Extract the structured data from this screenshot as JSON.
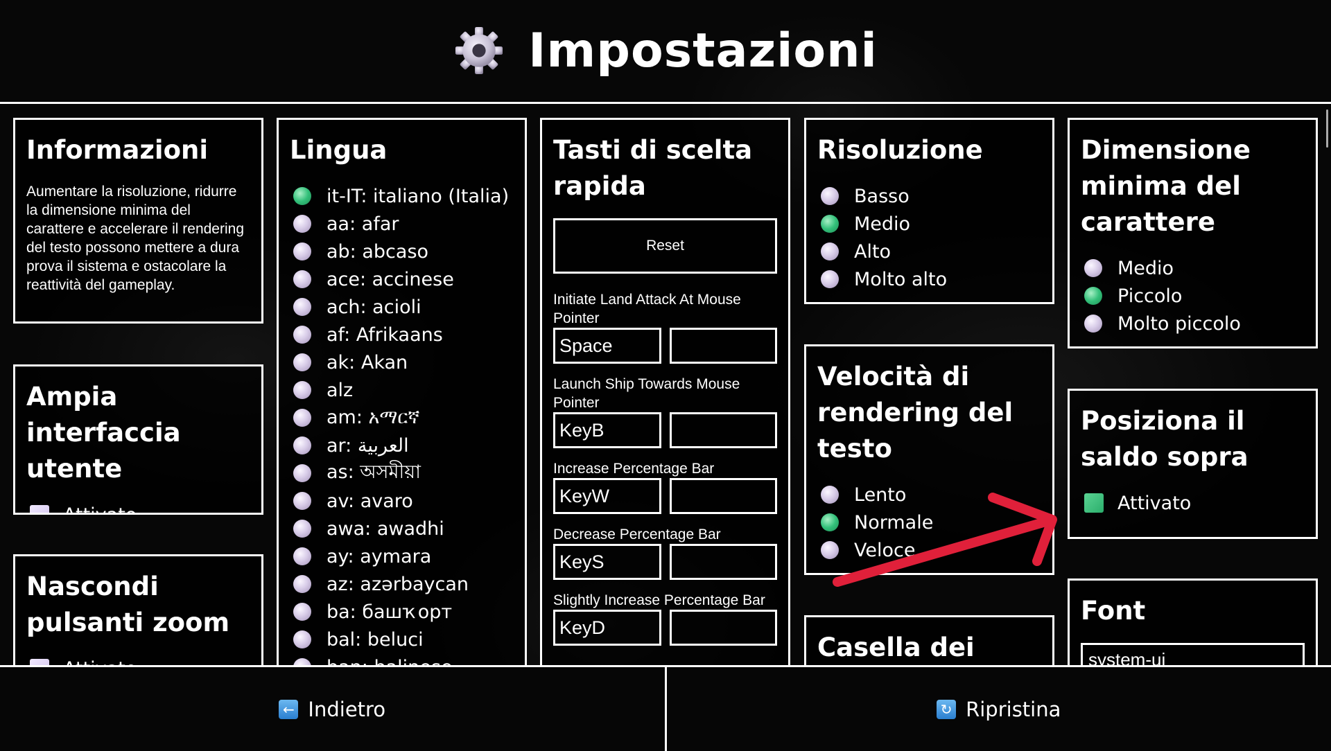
{
  "header": {
    "title": "Impostazioni"
  },
  "info": {
    "title": "Informazioni",
    "text": "Aumentare la risoluzione, ridurre la dimensione minima del carattere e accelerare il rendering del testo possono mettere a dura prova il sistema e ostacolare la reattività del gameplay."
  },
  "wide_ui": {
    "title": "Ampia interfaccia utente",
    "option": "Attivato",
    "checked": false
  },
  "hide_zoom": {
    "title": "Nascondi pulsanti zoom",
    "option": "Attivato",
    "checked": false
  },
  "language": {
    "title": "Lingua",
    "items": [
      {
        "label": "it-IT: italiano (Italia)",
        "selected": true
      },
      {
        "label": "aa: afar",
        "selected": false
      },
      {
        "label": "ab: abcaso",
        "selected": false
      },
      {
        "label": "ace: accinese",
        "selected": false
      },
      {
        "label": "ach: acioli",
        "selected": false
      },
      {
        "label": "af: Afrikaans",
        "selected": false
      },
      {
        "label": "ak: Akan",
        "selected": false
      },
      {
        "label": "alz",
        "selected": false
      },
      {
        "label": "am: አማርኛ",
        "selected": false
      },
      {
        "label": "ar: العربية",
        "selected": false
      },
      {
        "label": "as: অসমীয়া",
        "selected": false
      },
      {
        "label": "av: avaro",
        "selected": false
      },
      {
        "label": "awa: awadhi",
        "selected": false
      },
      {
        "label": "ay: aymara",
        "selected": false
      },
      {
        "label": "az: azərbaycan",
        "selected": false
      },
      {
        "label": "ba: башҡорт",
        "selected": false
      },
      {
        "label": "bal: beluci",
        "selected": false
      },
      {
        "label": "ban: balinese",
        "selected": false
      }
    ]
  },
  "hotkeys": {
    "title": "Tasti di scelta rapida",
    "reset_label": "Reset",
    "items": [
      {
        "label": "Initiate Land Attack At Mouse Pointer",
        "key": "Space",
        "alt": ""
      },
      {
        "label": "Launch Ship Towards Mouse Pointer",
        "key": "KeyB",
        "alt": ""
      },
      {
        "label": "Increase Percentage Bar",
        "key": "KeyW",
        "alt": ""
      },
      {
        "label": "Decrease Percentage Bar",
        "key": "KeyS",
        "alt": ""
      },
      {
        "label": "Slightly Increase Percentage Bar",
        "key": "KeyD",
        "alt": ""
      }
    ]
  },
  "resolution": {
    "title": "Risoluzione",
    "options": [
      {
        "label": "Basso",
        "selected": false
      },
      {
        "label": "Medio",
        "selected": true
      },
      {
        "label": "Alto",
        "selected": false
      },
      {
        "label": "Molto alto",
        "selected": false
      }
    ]
  },
  "text_speed": {
    "title": "Velocità di rendering del testo",
    "options": [
      {
        "label": "Lento",
        "selected": false
      },
      {
        "label": "Normale",
        "selected": true
      },
      {
        "label": "Veloce",
        "selected": false
      }
    ]
  },
  "checkbox_panel": {
    "title": "Casella dei"
  },
  "min_font": {
    "title": "Dimensione minima del carattere",
    "options": [
      {
        "label": "Medio",
        "selected": false
      },
      {
        "label": "Piccolo",
        "selected": true
      },
      {
        "label": "Molto piccolo",
        "selected": false
      }
    ]
  },
  "balance_top": {
    "title": "Posiziona il saldo sopra",
    "option": "Attivato",
    "checked": true
  },
  "font": {
    "title": "Font",
    "value": "system-ui"
  },
  "footer": {
    "back_label": "Indietro",
    "reset_label": "Ripristina"
  },
  "colors": {
    "selected": "#33c07a",
    "unselected": "#d8cce8",
    "annotation_arrow": "#e0203a"
  }
}
